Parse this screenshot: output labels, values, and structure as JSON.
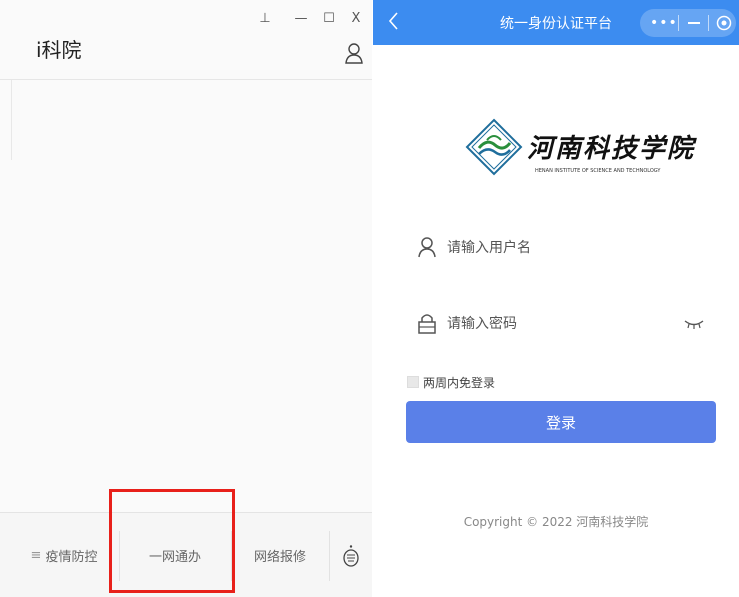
{
  "left_window": {
    "title": "i科院",
    "controls": {
      "pin": "⊥",
      "minimize": "—",
      "maximize": "☐",
      "close": "X"
    },
    "bottom_tabs": [
      {
        "label": "疫情防控",
        "prefix": "≡"
      },
      {
        "label": "一网通办"
      },
      {
        "label": "网络报修"
      }
    ]
  },
  "right_window": {
    "title": "统一身份认证平台",
    "capsule_more": "•••",
    "logo": {
      "name": "河南科技学院",
      "english": "HENAN INSTITUTE OF SCIENCE AND TECHNOLOGY"
    },
    "username": {
      "placeholder": "请输入用户名",
      "value": ""
    },
    "password": {
      "placeholder": "请输入密码",
      "value": ""
    },
    "remember_label": "两周内免登录",
    "login_label": "登录",
    "copyright": "Copyright © 2022 河南科技学院"
  },
  "colors": {
    "topbar": "#3c8cf0",
    "login_button": "#5a80e8",
    "highlight": "#e8201a"
  }
}
